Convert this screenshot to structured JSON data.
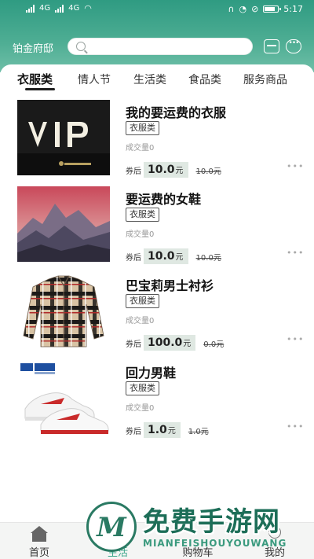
{
  "status_bar": {
    "network_left": "4G",
    "network_right": "4G",
    "time": "5:17"
  },
  "header": {
    "location": "铂金府邸",
    "search_placeholder": "",
    "accent_color": "#3aa68a"
  },
  "tabs": [
    {
      "label": "衣服类",
      "active": true
    },
    {
      "label": "情人节",
      "active": false
    },
    {
      "label": "生活类",
      "active": false
    },
    {
      "label": "食品类",
      "active": false
    },
    {
      "label": "服务商品",
      "active": false
    }
  ],
  "products": [
    {
      "name": "我的要运费的衣服",
      "category": "衣服类",
      "sold": "成交量0",
      "coupon_label": "券后",
      "price": "10.0",
      "unit": "元",
      "original_price": "10.0元",
      "image": "vip-icon"
    },
    {
      "name": "要运费的女鞋",
      "category": "衣服类",
      "sold": "成交量0",
      "coupon_label": "券后",
      "price": "10.0",
      "unit": "元",
      "original_price": "10.0元",
      "image": "mountain-photo"
    },
    {
      "name": "巴宝莉男士衬衫",
      "category": "衣服类",
      "sold": "成交量0",
      "coupon_label": "券后",
      "price": "100.0",
      "unit": "元",
      "original_price": "0.0元",
      "image": "plaid-shirt"
    },
    {
      "name": "回力男鞋",
      "category": "衣服类",
      "sold": "成交量0",
      "coupon_label": "券后",
      "price": "1.0",
      "unit": "元",
      "original_price": "1.0元",
      "image": "sneakers"
    }
  ],
  "bottom_nav": [
    {
      "label": "首页",
      "icon": "home-icon",
      "active": false
    },
    {
      "label": "生活",
      "icon": "life-icon",
      "active": true
    },
    {
      "label": "购物车",
      "icon": "cart-icon",
      "active": false
    },
    {
      "label": "我的",
      "icon": "profile-icon",
      "active": false
    }
  ],
  "watermark": {
    "text_cn": "免费手游网",
    "text_en": "MIANFEISHOUYOUWANG",
    "logo_letter": "M"
  }
}
